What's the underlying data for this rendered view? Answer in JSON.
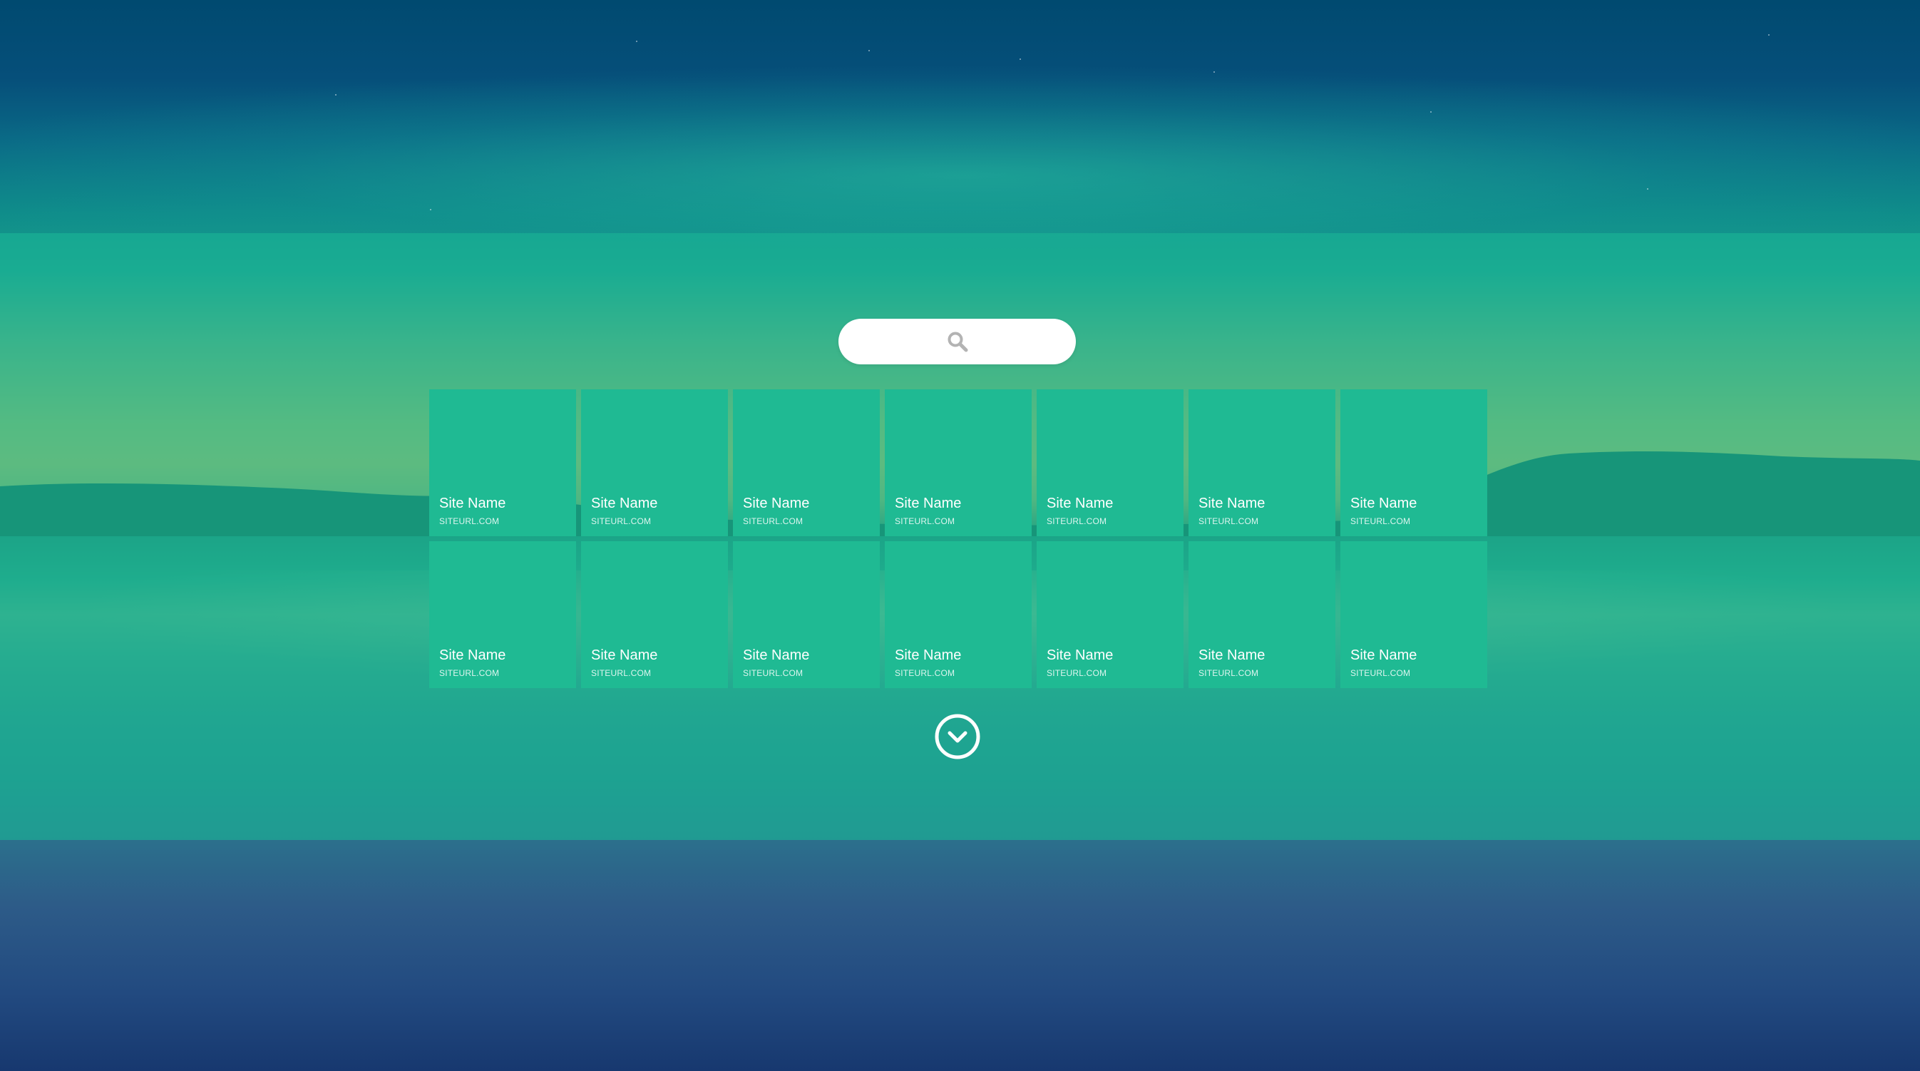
{
  "search": {
    "placeholder": "",
    "icon": "search-icon"
  },
  "tiles": [
    {
      "name": "Site Name",
      "url": "SITEURL.COM"
    },
    {
      "name": "Site Name",
      "url": "SITEURL.COM"
    },
    {
      "name": "Site Name",
      "url": "SITEURL.COM"
    },
    {
      "name": "Site Name",
      "url": "SITEURL.COM"
    },
    {
      "name": "Site Name",
      "url": "SITEURL.COM"
    },
    {
      "name": "Site Name",
      "url": "SITEURL.COM"
    },
    {
      "name": "Site Name",
      "url": "SITEURL.COM"
    },
    {
      "name": "Site Name",
      "url": "SITEURL.COM"
    },
    {
      "name": "Site Name",
      "url": "SITEURL.COM"
    },
    {
      "name": "Site Name",
      "url": "SITEURL.COM"
    },
    {
      "name": "Site Name",
      "url": "SITEURL.COM"
    },
    {
      "name": "Site Name",
      "url": "SITEURL.COM"
    },
    {
      "name": "Site Name",
      "url": "SITEURL.COM"
    },
    {
      "name": "Site Name",
      "url": "SITEURL.COM"
    }
  ],
  "more_button": {
    "icon": "chevron-down-circle-icon"
  },
  "colors": {
    "panel_overlay": "#1ab596",
    "tile": "#1fba93",
    "search_bg": "#ffffff",
    "search_icon": "#b3b3b3"
  }
}
